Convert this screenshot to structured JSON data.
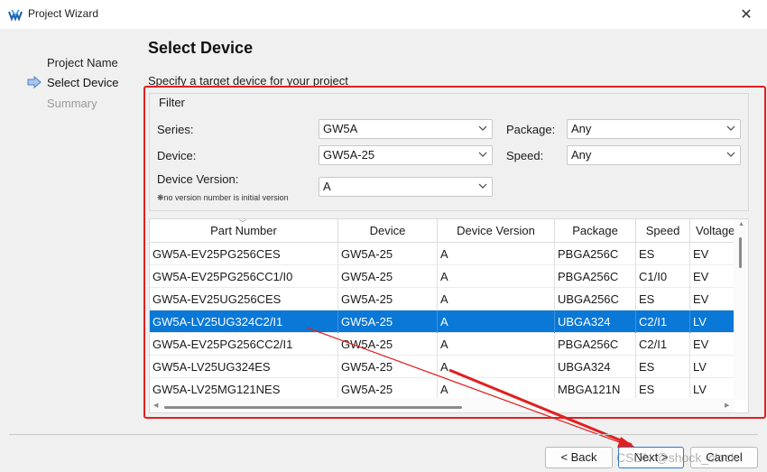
{
  "window": {
    "title": "Project Wizard",
    "close_glyph": "✕"
  },
  "steps": [
    {
      "label": "Project Name",
      "state": "done"
    },
    {
      "label": "Select Device",
      "state": "current"
    },
    {
      "label": "Summary",
      "state": "pending"
    }
  ],
  "page": {
    "title": "Select Device",
    "subtitle": "Specify a target device for your project"
  },
  "filter": {
    "legend": "Filter",
    "series_label": "Series:",
    "series_value": "GW5A",
    "device_label": "Device:",
    "device_value": "GW5A-25",
    "version_label": "Device Version:",
    "version_note": "❋no version number is initial version",
    "version_value": "A",
    "package_label": "Package:",
    "package_value": "Any",
    "speed_label": "Speed:",
    "speed_value": "Any"
  },
  "table": {
    "columns": [
      "Part Number",
      "Device",
      "Device Version",
      "Package",
      "Speed",
      "Voltage"
    ],
    "rows": [
      [
        "GW5A-EV25PG256CES",
        "GW5A-25",
        "A",
        "PBGA256C",
        "ES",
        "EV"
      ],
      [
        "GW5A-EV25PG256CC1/I0",
        "GW5A-25",
        "A",
        "PBGA256C",
        "C1/I0",
        "EV"
      ],
      [
        "GW5A-EV25UG256CES",
        "GW5A-25",
        "A",
        "UBGA256C",
        "ES",
        "EV"
      ],
      [
        "GW5A-LV25UG324C2/I1",
        "GW5A-25",
        "A",
        "UBGA324",
        "C2/I1",
        "LV"
      ],
      [
        "GW5A-EV25PG256CC2/I1",
        "GW5A-25",
        "A",
        "PBGA256C",
        "C2/I1",
        "EV"
      ],
      [
        "GW5A-LV25UG324ES",
        "GW5A-25",
        "A",
        "UBGA324",
        "ES",
        "LV"
      ],
      [
        "GW5A-LV25MG121NES",
        "GW5A-25",
        "A",
        "MBGA121N",
        "ES",
        "LV"
      ]
    ],
    "selected_row": 3
  },
  "buttons": {
    "back": "< Back",
    "next": "Next >",
    "cancel": "Cancel"
  },
  "watermark": "CSDN @shock_clock",
  "colors": {
    "selection": "#0a78d7",
    "annotation_red": "#e02020",
    "step_arrow": "#4a7fc4"
  }
}
